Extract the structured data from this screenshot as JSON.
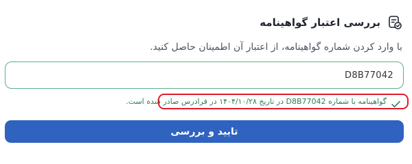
{
  "header": {
    "icon": "certificate-check-icon",
    "title": "بررسی اعتبار گواهینامه"
  },
  "description": "با وارد کردن شماره گواهینامه، از اعتبار آن اطمینان حاصل کنید.",
  "input": {
    "value": "D8B77042"
  },
  "result": {
    "icon": "checkmark-icon",
    "message": "گواهینامه با شماره D8B77042 در تاریخ ۱۴۰۴/۱۰/۲۸ در فرادرس صادر شده است.",
    "status_color": "#2e7d5b",
    "highlight_color": "#e01b2a"
  },
  "confirm_button": {
    "label": "تایید و بررسی",
    "color": "#2f63bf"
  }
}
